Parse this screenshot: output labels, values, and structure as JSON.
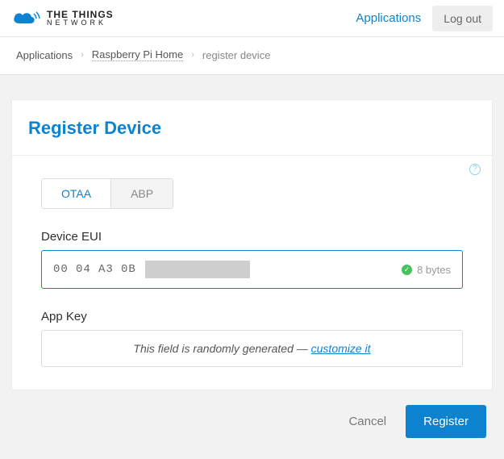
{
  "brand": {
    "line1": "THE THINGS",
    "line2": "NETWORK"
  },
  "topnav": {
    "applications": "Applications",
    "logout": "Log out"
  },
  "breadcrumb": {
    "items": [
      "Applications",
      "Raspberry Pi Home",
      "register device"
    ]
  },
  "page": {
    "title": "Register Device"
  },
  "tabs": {
    "active": "OTAA",
    "inactive": "ABP"
  },
  "device_eui": {
    "label": "Device EUI",
    "visible_bytes": [
      "00",
      "04",
      "A3",
      "0B"
    ],
    "status_text": "8 bytes"
  },
  "app_key": {
    "label": "App Key",
    "hint_prefix": "This field is randomly generated — ",
    "hint_action": "customize it"
  },
  "footer": {
    "cancel": "Cancel",
    "submit": "Register"
  }
}
